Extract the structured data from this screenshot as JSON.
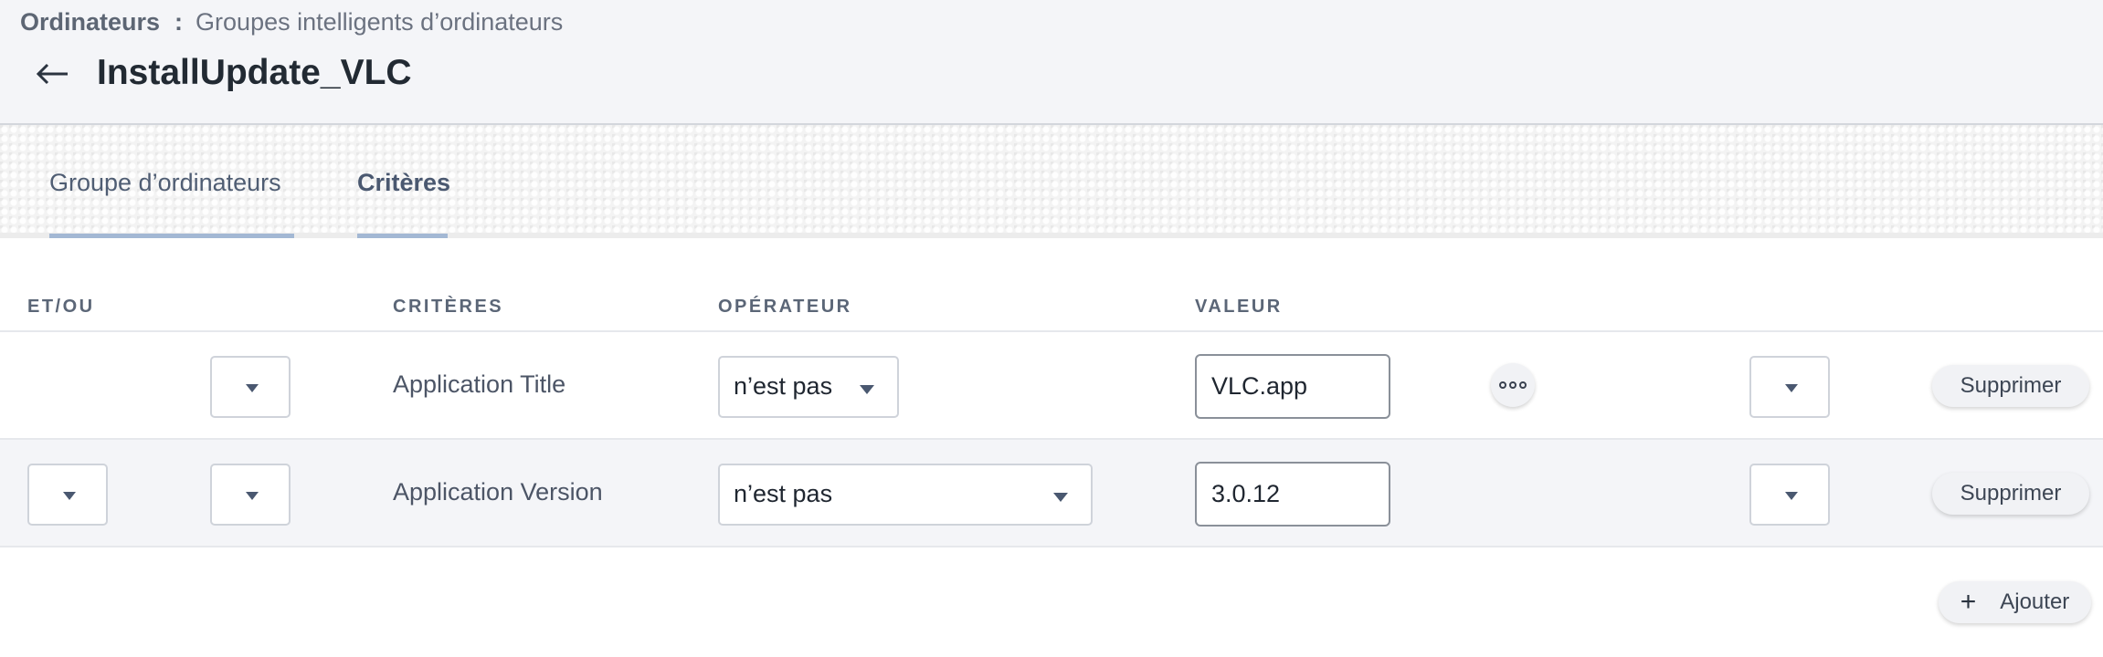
{
  "breadcrumb": {
    "root": "Ordinateurs",
    "separator": ":",
    "current": "Groupes intelligents d’ordinateurs"
  },
  "header": {
    "back_icon": "arrow-left-icon",
    "title": "InstallUpdate_VLC"
  },
  "tabs": [
    {
      "label": "Groupe d’ordinateurs"
    },
    {
      "label": "Critères",
      "selected": true
    }
  ],
  "table": {
    "columns": [
      "ET/OU",
      "CRITÈRES",
      "OPÉRATEUR",
      "VALEUR"
    ],
    "rows": [
      {
        "criteria": "Application Title",
        "operator": "n’est pas",
        "value": "VLC.app",
        "delete_label": "Supprimer"
      },
      {
        "criteria": "Application Version",
        "operator": "n’est pas",
        "value": "3.0.12",
        "delete_label": "Supprimer"
      }
    ]
  },
  "actions": {
    "add_label": "Ajouter",
    "add_icon": "plus-icon",
    "more_icon": "more-options-icon"
  },
  "colors": {
    "topbar_bg": "#f4f5f8",
    "tab_underline": "#a3b8d4",
    "title_text": "#222a33",
    "header_text": "#5b6677"
  }
}
